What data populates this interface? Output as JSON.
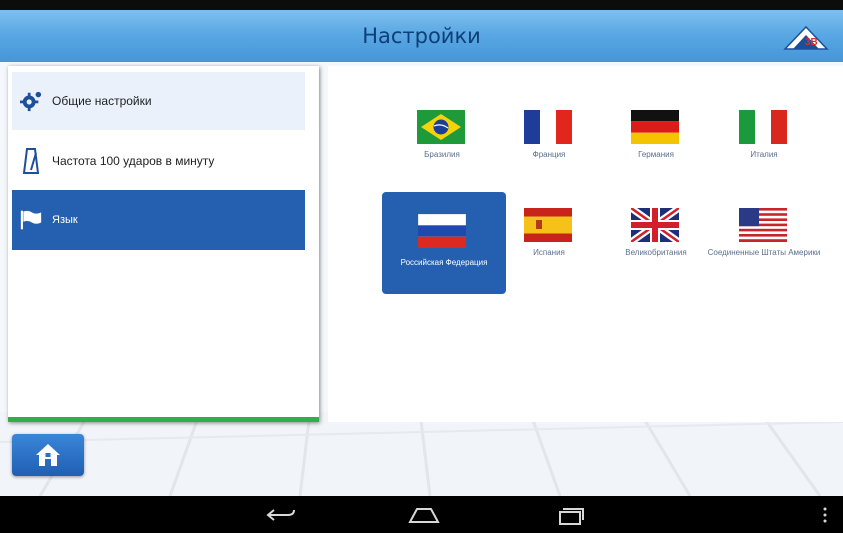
{
  "header": {
    "title": "Настройки",
    "logo_icon": "3b-scientific-logo-icon"
  },
  "sidebar": {
    "items": [
      {
        "label": "Общие настройки",
        "icon": "gear-icon"
      },
      {
        "label": "Частота 100 ударов в минуту",
        "icon": "metronome-icon"
      },
      {
        "label": "Язык",
        "icon": "flag-icon",
        "selected": true
      }
    ]
  },
  "languages": [
    {
      "name": "Бразилия",
      "flag": "brazil-flag-icon"
    },
    {
      "name": "Франция",
      "flag": "france-flag-icon"
    },
    {
      "name": "Германия",
      "flag": "germany-flag-icon"
    },
    {
      "name": "Италия",
      "flag": "italy-flag-icon"
    },
    {
      "name": "Российская Федерация",
      "flag": "russia-flag-icon",
      "selected": true
    },
    {
      "name": "Испания",
      "flag": "spain-flag-icon"
    },
    {
      "name": "Великобритания",
      "flag": "uk-flag-icon"
    },
    {
      "name": "Соединенные Штаты Америки",
      "flag": "usa-flag-icon"
    }
  ],
  "home_button": {
    "icon": "home-icon"
  },
  "system_nav": {
    "back": "back-icon",
    "home": "home-outline-icon",
    "recents": "recents-icon",
    "menu": "overflow-menu-icon"
  },
  "colors": {
    "header": "#5aa8e4",
    "selected": "#245fb0",
    "accent_bar": "#2cb04a"
  }
}
